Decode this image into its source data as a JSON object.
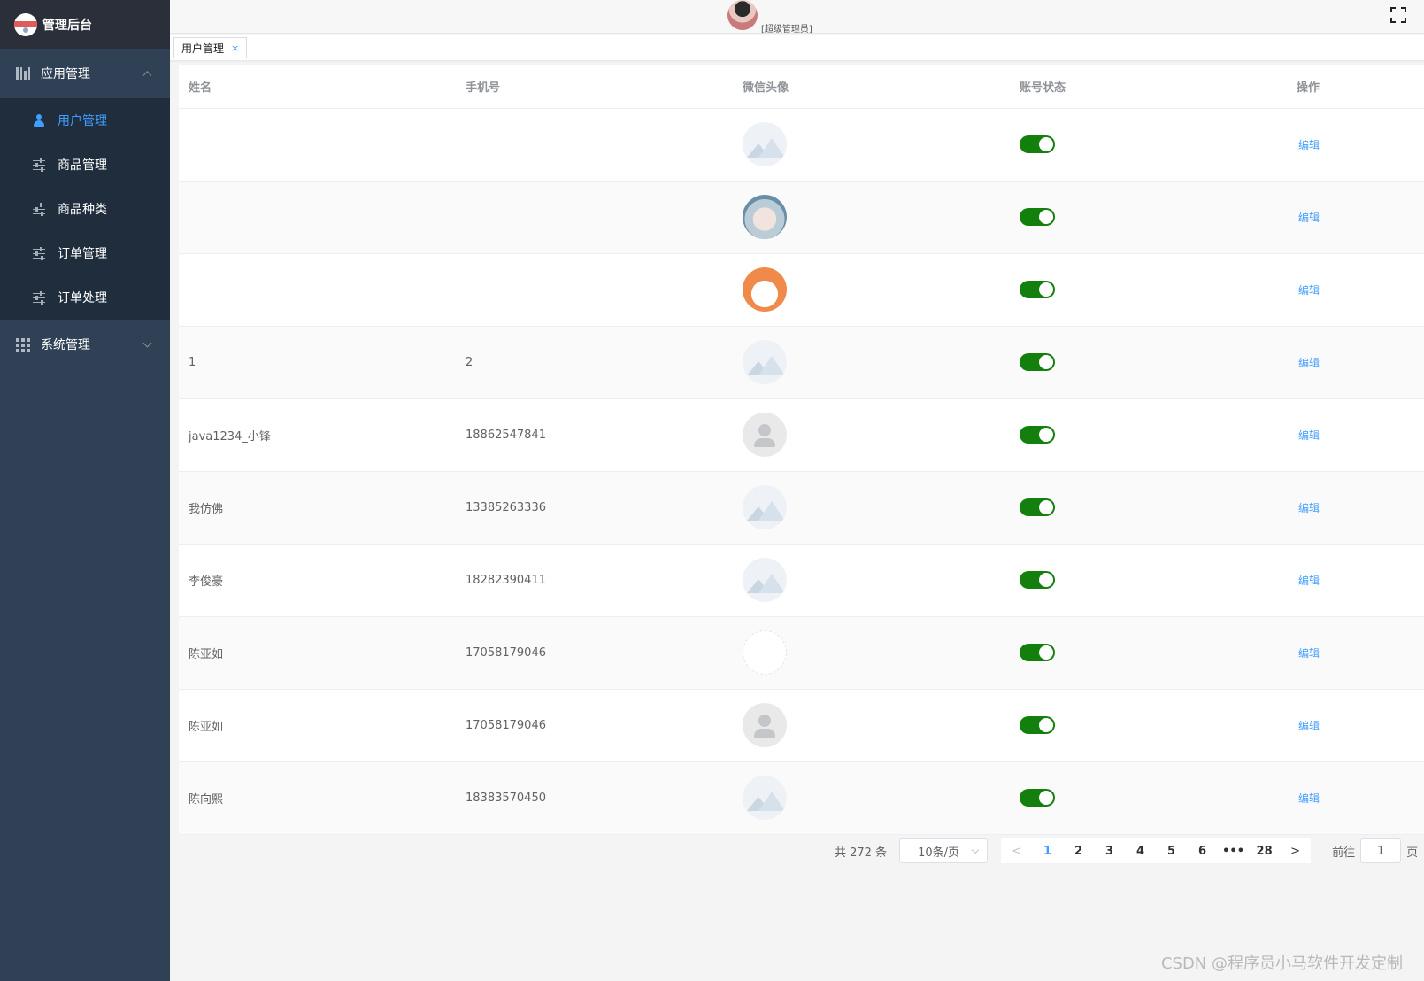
{
  "app": {
    "title": "管理后台"
  },
  "sidebar": {
    "groups": [
      {
        "label": "应用管理",
        "expanded": true,
        "items": [
          {
            "label": "用户管理",
            "icon": "user-icon",
            "active": true
          },
          {
            "label": "商品管理",
            "icon": "sliders-icon"
          },
          {
            "label": "商品种类",
            "icon": "sliders-icon"
          },
          {
            "label": "订单管理",
            "icon": "sliders-icon"
          },
          {
            "label": "订单处理",
            "icon": "sliders-icon"
          }
        ]
      },
      {
        "label": "系统管理",
        "expanded": false,
        "items": []
      }
    ]
  },
  "header": {
    "user_role": "[超级管理员]"
  },
  "tags": [
    {
      "label": "用户管理",
      "close": "×"
    }
  ],
  "table": {
    "columns": [
      "姓名",
      "手机号",
      "微信头像",
      "账号状态",
      "操作"
    ],
    "rows": [
      {
        "name": "",
        "phone": "",
        "avatar": "placeholder",
        "status": true,
        "action": "编辑"
      },
      {
        "name": "",
        "phone": "",
        "avatar": "photo",
        "status": true,
        "action": "编辑"
      },
      {
        "name": "",
        "phone": "",
        "avatar": "cartoon",
        "status": true,
        "action": "编辑"
      },
      {
        "name": "1",
        "phone": "2",
        "avatar": "placeholder",
        "status": true,
        "action": "编辑"
      },
      {
        "name": "java1234_小锋",
        "phone": "18862547841",
        "avatar": "default",
        "status": true,
        "action": "编辑"
      },
      {
        "name": "我仿佛",
        "phone": "13385263336",
        "avatar": "placeholder",
        "status": true,
        "action": "编辑"
      },
      {
        "name": "李俊豪",
        "phone": "18282390411",
        "avatar": "placeholder",
        "status": true,
        "action": "编辑"
      },
      {
        "name": "陈亚如",
        "phone": "17058179046",
        "avatar": "blank",
        "status": true,
        "action": "编辑"
      },
      {
        "name": "陈亚如",
        "phone": "17058179046",
        "avatar": "default",
        "status": true,
        "action": "编辑"
      },
      {
        "name": "陈向熙",
        "phone": "18383570450",
        "avatar": "placeholder",
        "status": true,
        "action": "编辑"
      }
    ]
  },
  "pagination": {
    "total_text": "共 272 条",
    "page_size": "10条/页",
    "pages": [
      "1",
      "2",
      "3",
      "4",
      "5",
      "6",
      "•••",
      "28"
    ],
    "current_page": "1",
    "prev": "<",
    "next": ">",
    "goto_label": "前往",
    "goto_value": "1",
    "goto_unit": "页"
  },
  "watermark": "CSDN @程序员小马软件开发定制",
  "colors": {
    "sidebar_bg": "#304156",
    "active": "#409eff",
    "switch_on": "#13800d"
  }
}
